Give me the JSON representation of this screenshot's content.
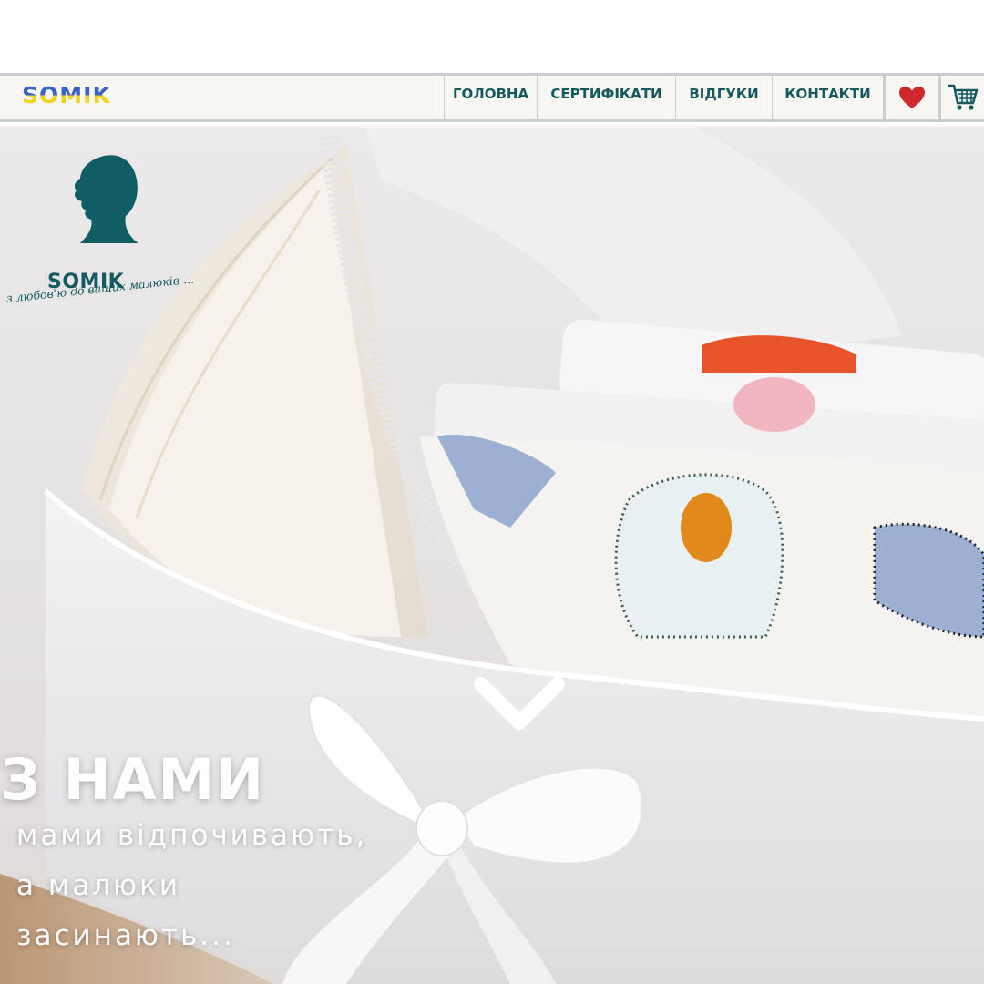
{
  "header": {
    "brand": "SOMIK",
    "nav": {
      "home": "ГОЛОВНА",
      "certificates": "СЕРТИФІКАТИ",
      "reviews": "ВІДГУКИ",
      "contacts": "КОНТАКТИ"
    },
    "icons": {
      "favorites": "heart-icon",
      "cart": "cart-icon"
    }
  },
  "hero": {
    "logo": {
      "name": "SOMIK",
      "tagline": "з любов'ю до ваших малюків ..."
    },
    "headline": "З НАМИ",
    "lines": [
      "мами відпочивають,",
      "а малюки",
      "засинають..."
    ],
    "scroll_icon": "chevron-down-icon"
  },
  "colors": {
    "brand_blue": "#3a63c9",
    "brand_yellow": "#f5d21c",
    "nav_text": "#125a5f",
    "heart": "#d0272d",
    "border": "#c9ced1"
  }
}
